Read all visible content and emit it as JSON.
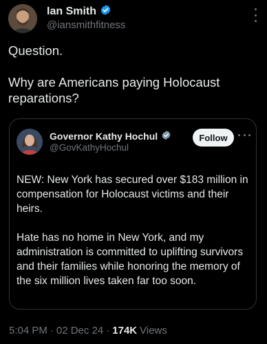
{
  "author": {
    "name": "Ian Smith",
    "handle": "@iansmithfitness",
    "verified_color": "#1d9bf0"
  },
  "tweet": {
    "lines": [
      "Question.",
      "Why are Americans paying Holocaust reparations?"
    ]
  },
  "quoted": {
    "name": "Governor Kathy Hochul",
    "handle": "@GovKathyHochul",
    "verified_color": "#829aab",
    "follow_label": "Follow",
    "paragraphs": [
      "NEW: New York has secured over $183 million in compensation for Holocaust victims and their heirs.",
      "Hate has no home in New York, and my administration is committed to uplifting survivors and their families while honoring the memory of the six million lives taken far too soon."
    ]
  },
  "meta": {
    "time": "5:04 PM",
    "date": "02 Dec 24",
    "views_count": "174K",
    "views_label": "Views",
    "separator": "·"
  },
  "colors": {
    "background": "#000000",
    "text": "#e7e9ea",
    "muted": "#71767b",
    "border": "#2f3336"
  }
}
